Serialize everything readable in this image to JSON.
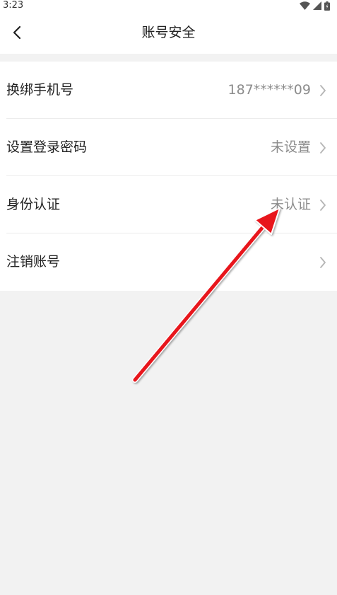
{
  "status_bar": {
    "time": "3:23",
    "icons": [
      "wifi-icon",
      "signal-icon",
      "battery-icon"
    ]
  },
  "header": {
    "title": "账号安全",
    "back_icon": "chevron-left-icon"
  },
  "settings": {
    "items": [
      {
        "label": "换绑手机号",
        "value": "187******09"
      },
      {
        "label": "设置登录密码",
        "value": "未设置"
      },
      {
        "label": "身份认证",
        "value": "未认证"
      },
      {
        "label": "注销账号",
        "value": ""
      }
    ]
  },
  "colors": {
    "background": "#f2f2f2",
    "surface": "#ffffff",
    "text_primary": "#222222",
    "text_secondary": "#8c8c8c",
    "annotation_arrow": "#e8141b"
  }
}
